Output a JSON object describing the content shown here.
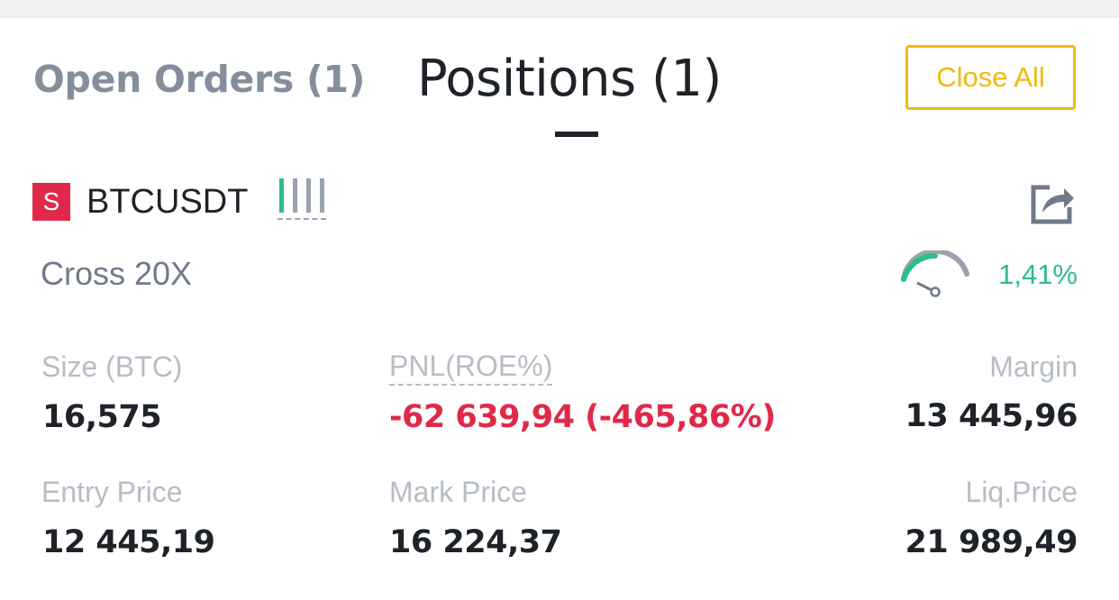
{
  "tabs": {
    "open_orders": "Open Orders (1)",
    "positions": "Positions  (1)"
  },
  "actions": {
    "close_all": "Close All"
  },
  "position": {
    "side": "S",
    "symbol": "BTCUSDT",
    "margin_mode": "Cross 20X",
    "margin_ratio": "1,41%",
    "margin_ratio_value": 1.41,
    "adl_level": 1,
    "fields": {
      "size_label": "Size (BTC)",
      "size_value": "16,575",
      "pnl_label": "PNL(ROE%)",
      "pnl_value": "-62 639,94 (-465,86%)",
      "margin_label": "Margin",
      "margin_value": "13 445,96",
      "entry_label": "Entry Price",
      "entry_value": "12 445,19",
      "mark_label": "Mark Price",
      "mark_value": "16 224,37",
      "liq_label": "Liq.Price",
      "liq_value": "21 989,49"
    }
  },
  "colors": {
    "accent": "#f0b90b",
    "sell": "#e0294a",
    "buy": "#2ebd85",
    "text_primary": "#1e2329",
    "text_secondary": "#b7bdc6"
  },
  "icons": {
    "share": "share-icon",
    "gauge": "margin-ratio-gauge-icon",
    "adl": "adl-indicator-icon"
  }
}
